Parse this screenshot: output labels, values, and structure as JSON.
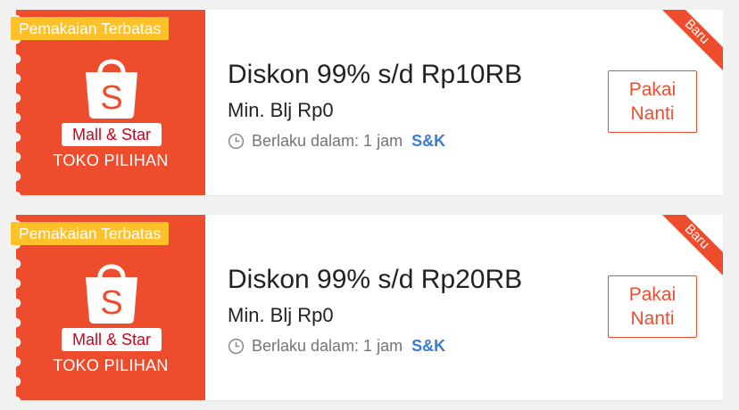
{
  "colors": {
    "brand": "#ee4d2d",
    "limited_tag": "#ffc12a",
    "terms_link": "#3b7bd4",
    "mall_red": "#d0011b"
  },
  "vouchers": [
    {
      "limited_label": "Pemakaian Terbatas",
      "bag_letter": "S",
      "mall_badge": "Mall & Star",
      "store_label": "TOKO PILIHAN",
      "title": "Diskon 99% s/d Rp10RB",
      "min_purchase": "Min. Blj Rp0",
      "validity": "Berlaku dalam: 1 jam",
      "terms": "S&K",
      "button": [
        "Pakai",
        "Nanti"
      ],
      "corner_badge": "Baru"
    },
    {
      "limited_label": "Pemakaian Terbatas",
      "bag_letter": "S",
      "mall_badge": "Mall & Star",
      "store_label": "TOKO PILIHAN",
      "title": "Diskon 99% s/d Rp20RB",
      "min_purchase": "Min. Blj Rp0",
      "validity": "Berlaku dalam: 1 jam",
      "terms": "S&K",
      "button": [
        "Pakai",
        "Nanti"
      ],
      "corner_badge": "Baru"
    }
  ]
}
